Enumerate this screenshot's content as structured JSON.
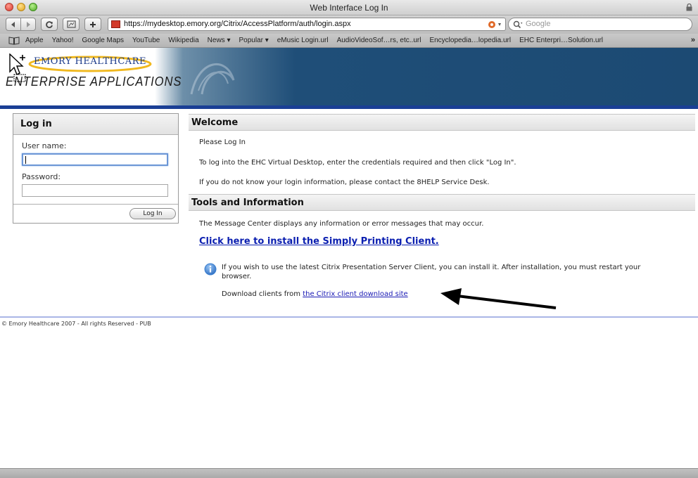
{
  "window": {
    "title": "Web Interface Log In"
  },
  "toolbar": {
    "url": "https://mydesktop.emory.org/Citrix/AccessPlatform/auth/login.aspx",
    "search_placeholder": "Google"
  },
  "bookmarks": {
    "items": [
      "Apple",
      "Yahoo!",
      "Google Maps",
      "YouTube",
      "Wikipedia",
      "News ▾",
      "Popular ▾",
      "eMusic Login.url",
      "AudioVideoSof…rs, etc..url",
      "Encyclopedia…lopedia.url",
      "EHC Enterpri…Solution.url"
    ],
    "more": "»"
  },
  "banner": {
    "logo_text": "EMORY HEALTHCARE",
    "subtitle": "ENTERPRISE APPLICATIONS"
  },
  "login": {
    "title": "Log in",
    "username_label": "User name:",
    "password_label": "Password:",
    "username_value": "",
    "password_value": "",
    "button_label": "Log In"
  },
  "welcome": {
    "title": "Welcome",
    "line1": "Please Log In",
    "line2": "To log into the EHC Virtual Desktop, enter the credentials required and then click \"Log In\".",
    "line3": "If you do not know your login information, please contact the 8HELP Service Desk."
  },
  "tools": {
    "title": "Tools and Information",
    "message": "The Message Center displays any information or error messages that may occur.",
    "install_link": "Click here to install the Simply Printing Client.",
    "info_text": "If you wish to use the latest Citrix Presentation Server Client, you can install it. After installation, you must restart your browser.",
    "download_prefix": "Download clients from",
    "download_link": "the Citrix client download site"
  },
  "footer": {
    "copyright": "© Emory Healthcare 2007 - All rights Reserved - PUB"
  }
}
